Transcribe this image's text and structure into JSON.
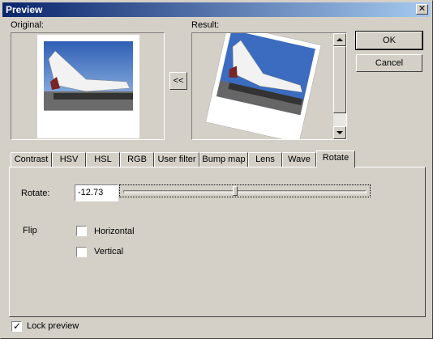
{
  "window": {
    "title": "Preview"
  },
  "original": {
    "label": "Original:"
  },
  "result": {
    "label": "Result:"
  },
  "copy_button": {
    "label": "<<"
  },
  "buttons": {
    "ok": "OK",
    "cancel": "Cancel"
  },
  "tabs": [
    {
      "label": "Contrast"
    },
    {
      "label": "HSV"
    },
    {
      "label": "HSL"
    },
    {
      "label": "RGB"
    },
    {
      "label": "User filter"
    },
    {
      "label": "Bump map"
    },
    {
      "label": "Lens"
    },
    {
      "label": "Wave"
    },
    {
      "label": "Rotate",
      "active": true
    }
  ],
  "rotate": {
    "label": "Rotate:",
    "value": "-12.73",
    "slider_fraction": 0.46
  },
  "flip": {
    "label": "Flip",
    "horizontal": "Horizontal",
    "vertical": "Vertical",
    "horizontal_checked": false,
    "vertical_checked": false
  },
  "lock_preview": {
    "label": "Lock preview",
    "checked": true
  }
}
